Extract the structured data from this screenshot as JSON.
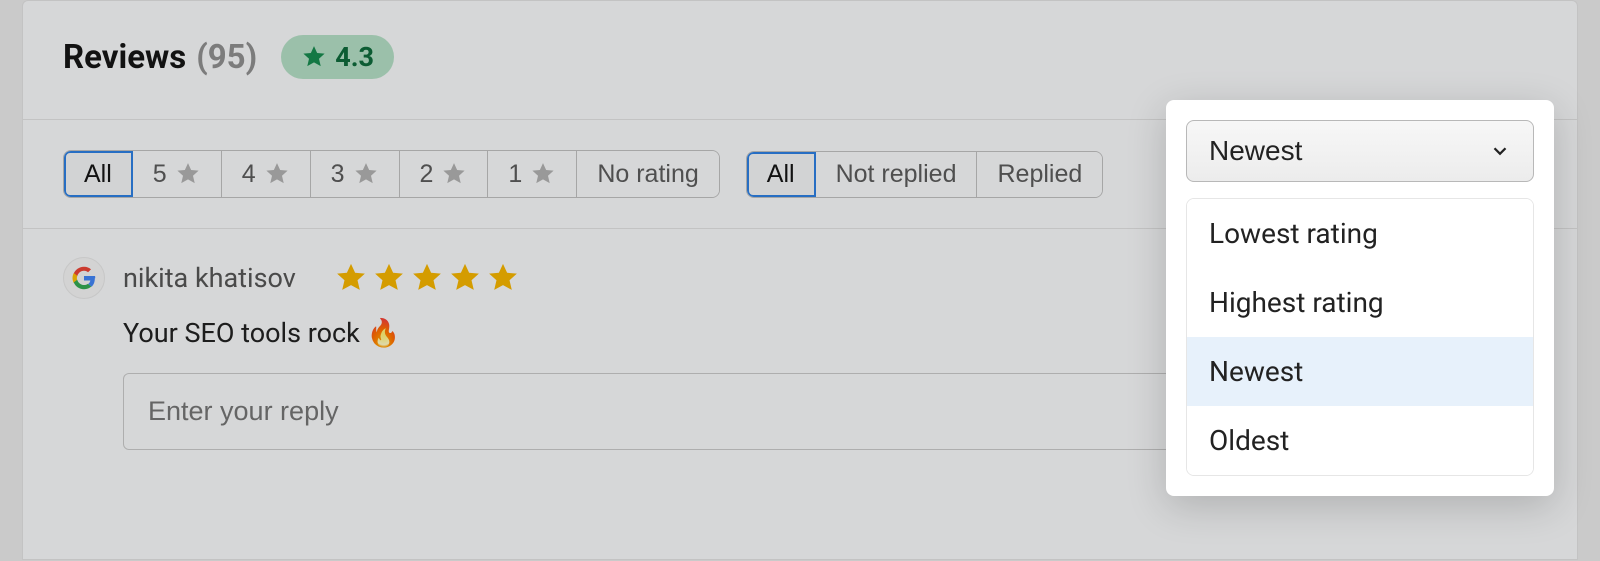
{
  "header": {
    "title": "Reviews",
    "count": "(95)",
    "rating": "4.3"
  },
  "filters": {
    "rating": {
      "all": "All",
      "five": "5",
      "four": "4",
      "three": "3",
      "two": "2",
      "one": "1",
      "none": "No rating"
    },
    "reply": {
      "all": "All",
      "not_replied": "Not replied",
      "replied": "Replied"
    }
  },
  "sort": {
    "trigger": "Newest",
    "options": {
      "lowest": "Lowest rating",
      "highest": "Highest rating",
      "newest": "Newest",
      "oldest": "Oldest"
    }
  },
  "review": {
    "source_icon": "google-icon",
    "reviewer": "nikita khatisov",
    "stars": 5,
    "text": "Your SEO tools rock 🔥",
    "reply_placeholder": "Enter your reply"
  }
}
